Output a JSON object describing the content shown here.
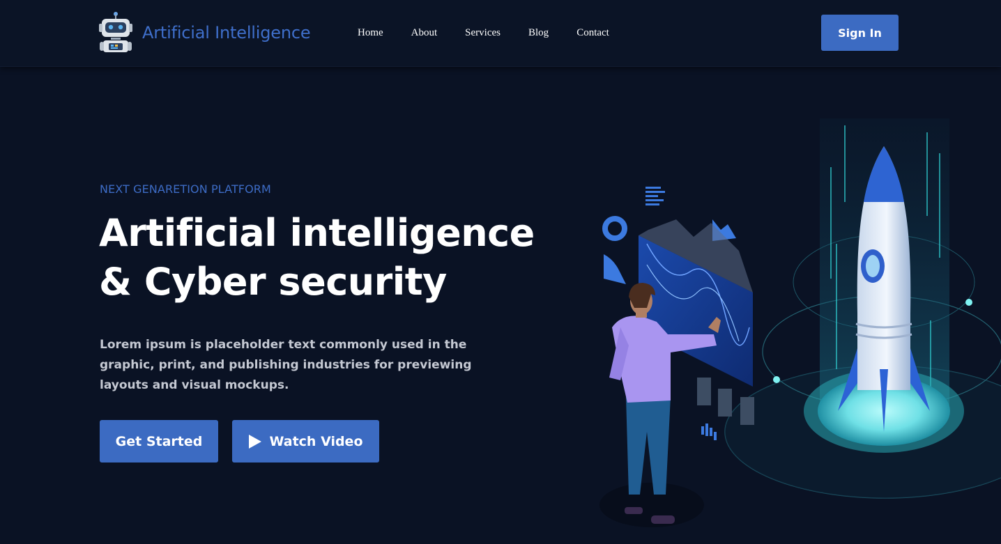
{
  "header": {
    "logo_text": "Artificial Intelligence",
    "nav": [
      "Home",
      "About",
      "Services",
      "Blog",
      "Contact"
    ],
    "signin_label": "Sign In"
  },
  "hero": {
    "eyebrow": "NEXT GENARETION PLATFORM",
    "title_line1": "Artificial intelligence",
    "title_line2": "& Cyber security",
    "description": "Lorem ipsum is placeholder text commonly used in the graphic, print, and publishing industries for previewing layouts and visual mockups.",
    "get_started_label": "Get Started",
    "watch_video_label": "Watch Video"
  },
  "icons": {
    "logo": "robot-icon",
    "play": "play-icon",
    "illustration": "rocket-analytics-illustration"
  },
  "colors": {
    "background": "#0a1224",
    "accent": "#3c6bc2",
    "logo_text": "#3f6fcb",
    "eyebrow": "#3d6cc6"
  }
}
